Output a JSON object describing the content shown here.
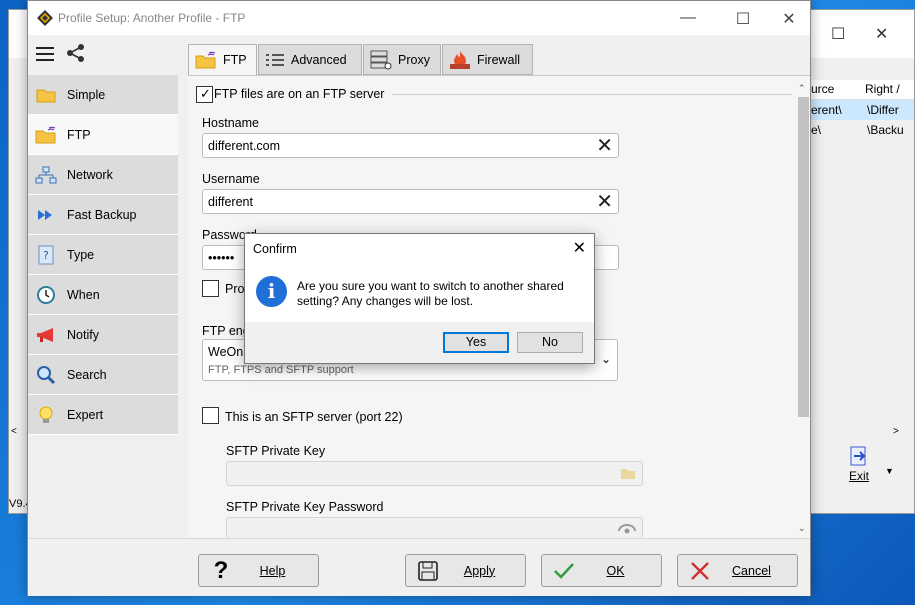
{
  "background_window": {
    "grid_headers": [
      "urce",
      "Right /"
    ],
    "grid_rows": [
      {
        "left": "erent\\",
        "right": "\\Differ"
      },
      {
        "left": "e\\",
        "right": "\\Backu"
      }
    ],
    "exit_label": "Exit",
    "version": "V9.4"
  },
  "dialog": {
    "title": "Profile Setup: Another Profile - FTP",
    "nav": [
      {
        "label": "Simple",
        "icon": "folder-icon"
      },
      {
        "label": "FTP",
        "icon": "ftp-folder-icon"
      },
      {
        "label": "Network",
        "icon": "network-icon"
      },
      {
        "label": "Fast Backup",
        "icon": "fast-backup-icon"
      },
      {
        "label": "Type",
        "icon": "type-icon"
      },
      {
        "label": "When",
        "icon": "clock-icon"
      },
      {
        "label": "Notify",
        "icon": "megaphone-icon"
      },
      {
        "label": "Search",
        "icon": "magnifier-icon"
      },
      {
        "label": "Expert",
        "icon": "lightbulb-icon"
      }
    ],
    "tabs": [
      {
        "label": "FTP"
      },
      {
        "label": "Advanced"
      },
      {
        "label": "Proxy"
      },
      {
        "label": "Firewall"
      }
    ],
    "ftp": {
      "enabled_label": "FTP files are on an FTP server",
      "hostname_label": "Hostname",
      "hostname_value": "different.com",
      "username_label": "Username",
      "username_value": "different",
      "password_label": "Password",
      "password_value": "••••••",
      "prompt_label": "Pro",
      "engine_label": "FTP eng",
      "engine_value": "WeOnly",
      "engine_sub": "FTP, FTPS and SFTP support",
      "sftp_label": "This is an SFTP server (port 22)",
      "sftp_key_label": "SFTP Private Key",
      "sftp_key_pw_label": "SFTP Private Key Password"
    },
    "buttons": {
      "help": "Help",
      "apply": "Apply",
      "ok": "OK",
      "cancel": "Cancel"
    }
  },
  "confirm": {
    "title": "Confirm",
    "message": "Are you sure you want to switch to another shared setting? Any changes will be lost.",
    "yes": "Yes",
    "no": "No"
  },
  "colors": {
    "accent": "#0078d7",
    "info": "#1f6fd6",
    "folder": "#f6c445"
  }
}
